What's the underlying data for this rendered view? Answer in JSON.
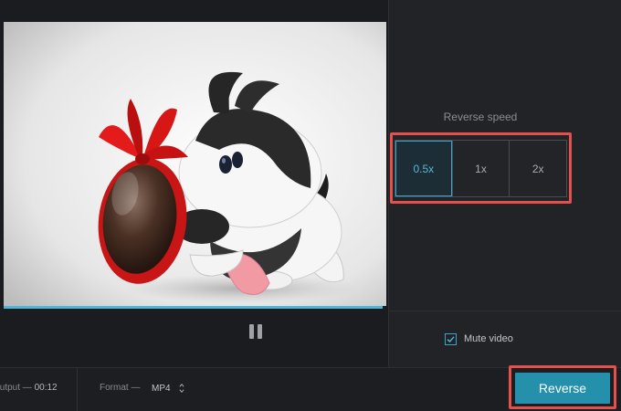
{
  "player": {
    "progress": 1.0,
    "pause_icon": "pause-icon",
    "video_subject": "cartoon-dog-holding-chocolate-egg"
  },
  "settings": {
    "speed_title": "Reverse speed",
    "speed_options": [
      "0.5x",
      "1x",
      "2x"
    ],
    "selected_speed": "0.5x",
    "mute_label": "Mute video",
    "mute_checked": true
  },
  "bottom": {
    "output_label": "Output —",
    "output_value": "00:12",
    "format_label": "Format —",
    "format_value": "MP4",
    "reverse_label": "Reverse"
  },
  "colors": {
    "accent": "#2590ac",
    "highlight": "#e4504c",
    "background": "#1f2023"
  }
}
